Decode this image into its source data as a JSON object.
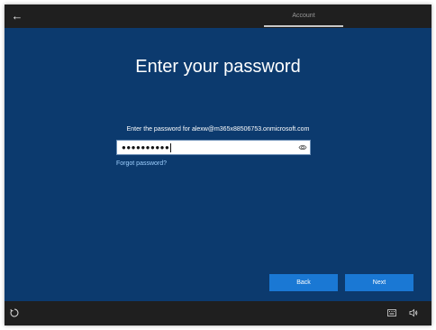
{
  "header": {
    "back_icon": "back-arrow-icon",
    "tab_label": "Account"
  },
  "main": {
    "title": "Enter your password",
    "prompt": "Enter the password for alexw@m365x88506753.onmicrosoft.com",
    "password_masked": "●●●●●●●●●●",
    "reveal_icon": "eye-icon",
    "forgot_link": "Forgot password?"
  },
  "buttons": {
    "back_label": "Back",
    "next_label": "Next"
  },
  "footer": {
    "ease_of_access_icon": "ease-of-access-icon",
    "keyboard_icon": "keyboard-icon",
    "volume_icon": "volume-icon"
  },
  "colors": {
    "background": "#0c3a6e",
    "button": "#1a78d4",
    "link": "#9fd0ff",
    "bar": "#1f1f1f"
  }
}
